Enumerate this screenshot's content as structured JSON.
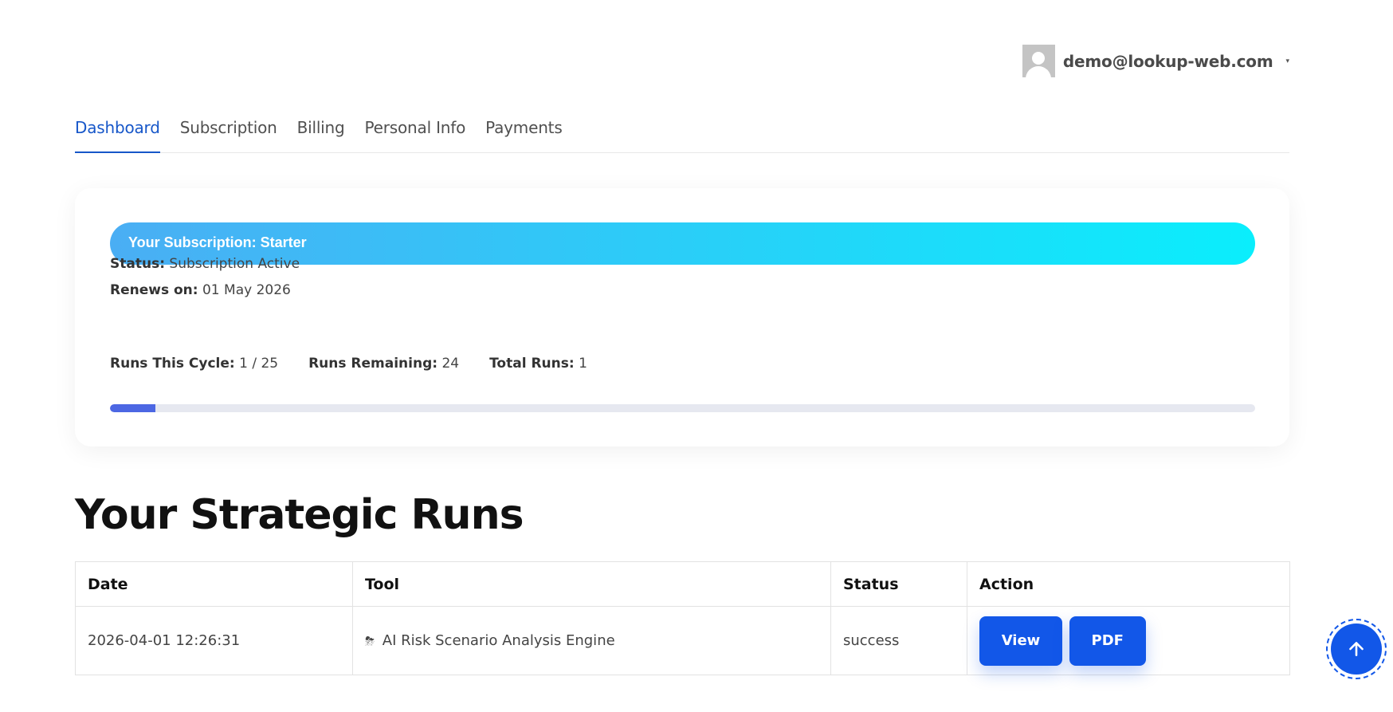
{
  "user": {
    "email": "demo@lookup-web.com",
    "avatar_icon": "user-avatar-icon",
    "caret": "▾"
  },
  "tabs": [
    {
      "label": "Dashboard",
      "active": true
    },
    {
      "label": "Subscription",
      "active": false
    },
    {
      "label": "Billing",
      "active": false
    },
    {
      "label": "Personal Info",
      "active": false
    },
    {
      "label": "Payments",
      "active": false
    }
  ],
  "subscription": {
    "banner": "Your Subscription: Starter",
    "status_label": "Status:",
    "status_value": "Subscription Active",
    "renews_label": "Renews on:",
    "renews_value": "01 May 2026",
    "runs_cycle_label": "Runs This Cycle:",
    "runs_cycle_value": "1 / 25",
    "runs_remaining_label": "Runs Remaining:",
    "runs_remaining_value": "24",
    "total_runs_label": "Total Runs:",
    "total_runs_value": "1",
    "progress_fraction": 0.04,
    "gradient_colors": [
      "#4aaef4",
      "#0aeefc"
    ],
    "progress_color": "#4c67e3"
  },
  "runs": {
    "title": "Your Strategic Runs",
    "headers": [
      "Date",
      "Tool",
      "Status",
      "Action"
    ],
    "rows": [
      {
        "date": "2026-04-01 12:26:31",
        "tool_emoji": "⛈",
        "tool": "AI Risk Scenario Analysis Engine",
        "status": "success",
        "view_label": "View",
        "pdf_label": "PDF"
      }
    ]
  },
  "accent_color": "#1257e8",
  "scroll_top_icon": "arrow-up-icon"
}
